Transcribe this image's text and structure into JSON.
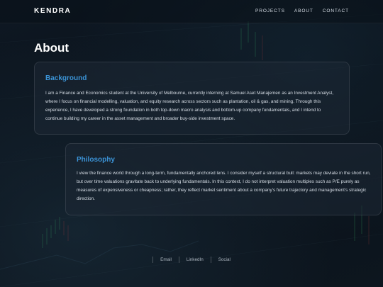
{
  "brand": {
    "name": "KENDRA"
  },
  "nav": {
    "items": [
      "PROJECTS",
      "ABOUT",
      "CONTACT"
    ]
  },
  "page": {
    "title": "About"
  },
  "background_card": {
    "heading": "Background",
    "body": "I am a Finance and Economics student at the University of Melbourne, currently interning at Samuel Aset Manajemen as an Investment Analyst, where I focus on financial modelling, valuation, and equity research across sectors such as plantation, oil & gas, and mining. Through this experience, I have developed a strong foundation in both top-down macro analysis and bottom-up company fundamentals, and I intend to continue building my career in the asset management and broader buy-side investment space."
  },
  "philosophy_card": {
    "heading": "Philosophy",
    "body": "I view the finance world through a long-term, fundamentally anchored lens. I consider myself a structural bull: markets may deviate in the short run, but over time valuations gravitate back to underlying fundamentals. In this context, I do not interpret valuation multiples such as P/E purely as measures of expensiveness or cheapness; rather, they reflect market sentiment about a company’s future trajectory and management’s strategic direction."
  },
  "footer": {
    "links": [
      "Email",
      "LinkedIn",
      "Social"
    ]
  },
  "colors": {
    "accent": "#3b93d6",
    "background": "#0b121c"
  }
}
